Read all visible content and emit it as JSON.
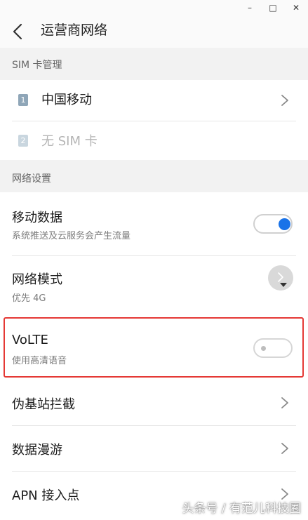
{
  "window": {
    "minimize": "–",
    "maximize": "□",
    "close": "✕"
  },
  "header": {
    "title": "运营商网络"
  },
  "sections": {
    "sim": "SIM 卡管理",
    "network": "网络设置"
  },
  "sim_cards": [
    {
      "slot": "1",
      "label": "中国移动",
      "enabled": true
    },
    {
      "slot": "2",
      "label": "无 SIM 卡",
      "enabled": false
    }
  ],
  "settings": {
    "mobile_data": {
      "title": "移动数据",
      "subtitle": "系统推送及云服务会产生流量",
      "on": true
    },
    "network_mode": {
      "title": "网络模式",
      "subtitle": "优先 4G"
    },
    "volte": {
      "title": "VoLTE",
      "subtitle": "使用高清语音",
      "on": false
    },
    "fake_station": {
      "title": "伪基站拦截"
    },
    "roaming": {
      "title": "数据漫游"
    },
    "apn": {
      "title": "APN 接入点"
    }
  },
  "watermark": "头条号 / 有范儿科技圈",
  "colors": {
    "accent": "#1a73e8",
    "highlight": "#e53935"
  },
  "icons": [
    "back-arrow-icon",
    "chevron-right-icon",
    "dropdown-arrow-icon",
    "toggle-switch-icon"
  ]
}
